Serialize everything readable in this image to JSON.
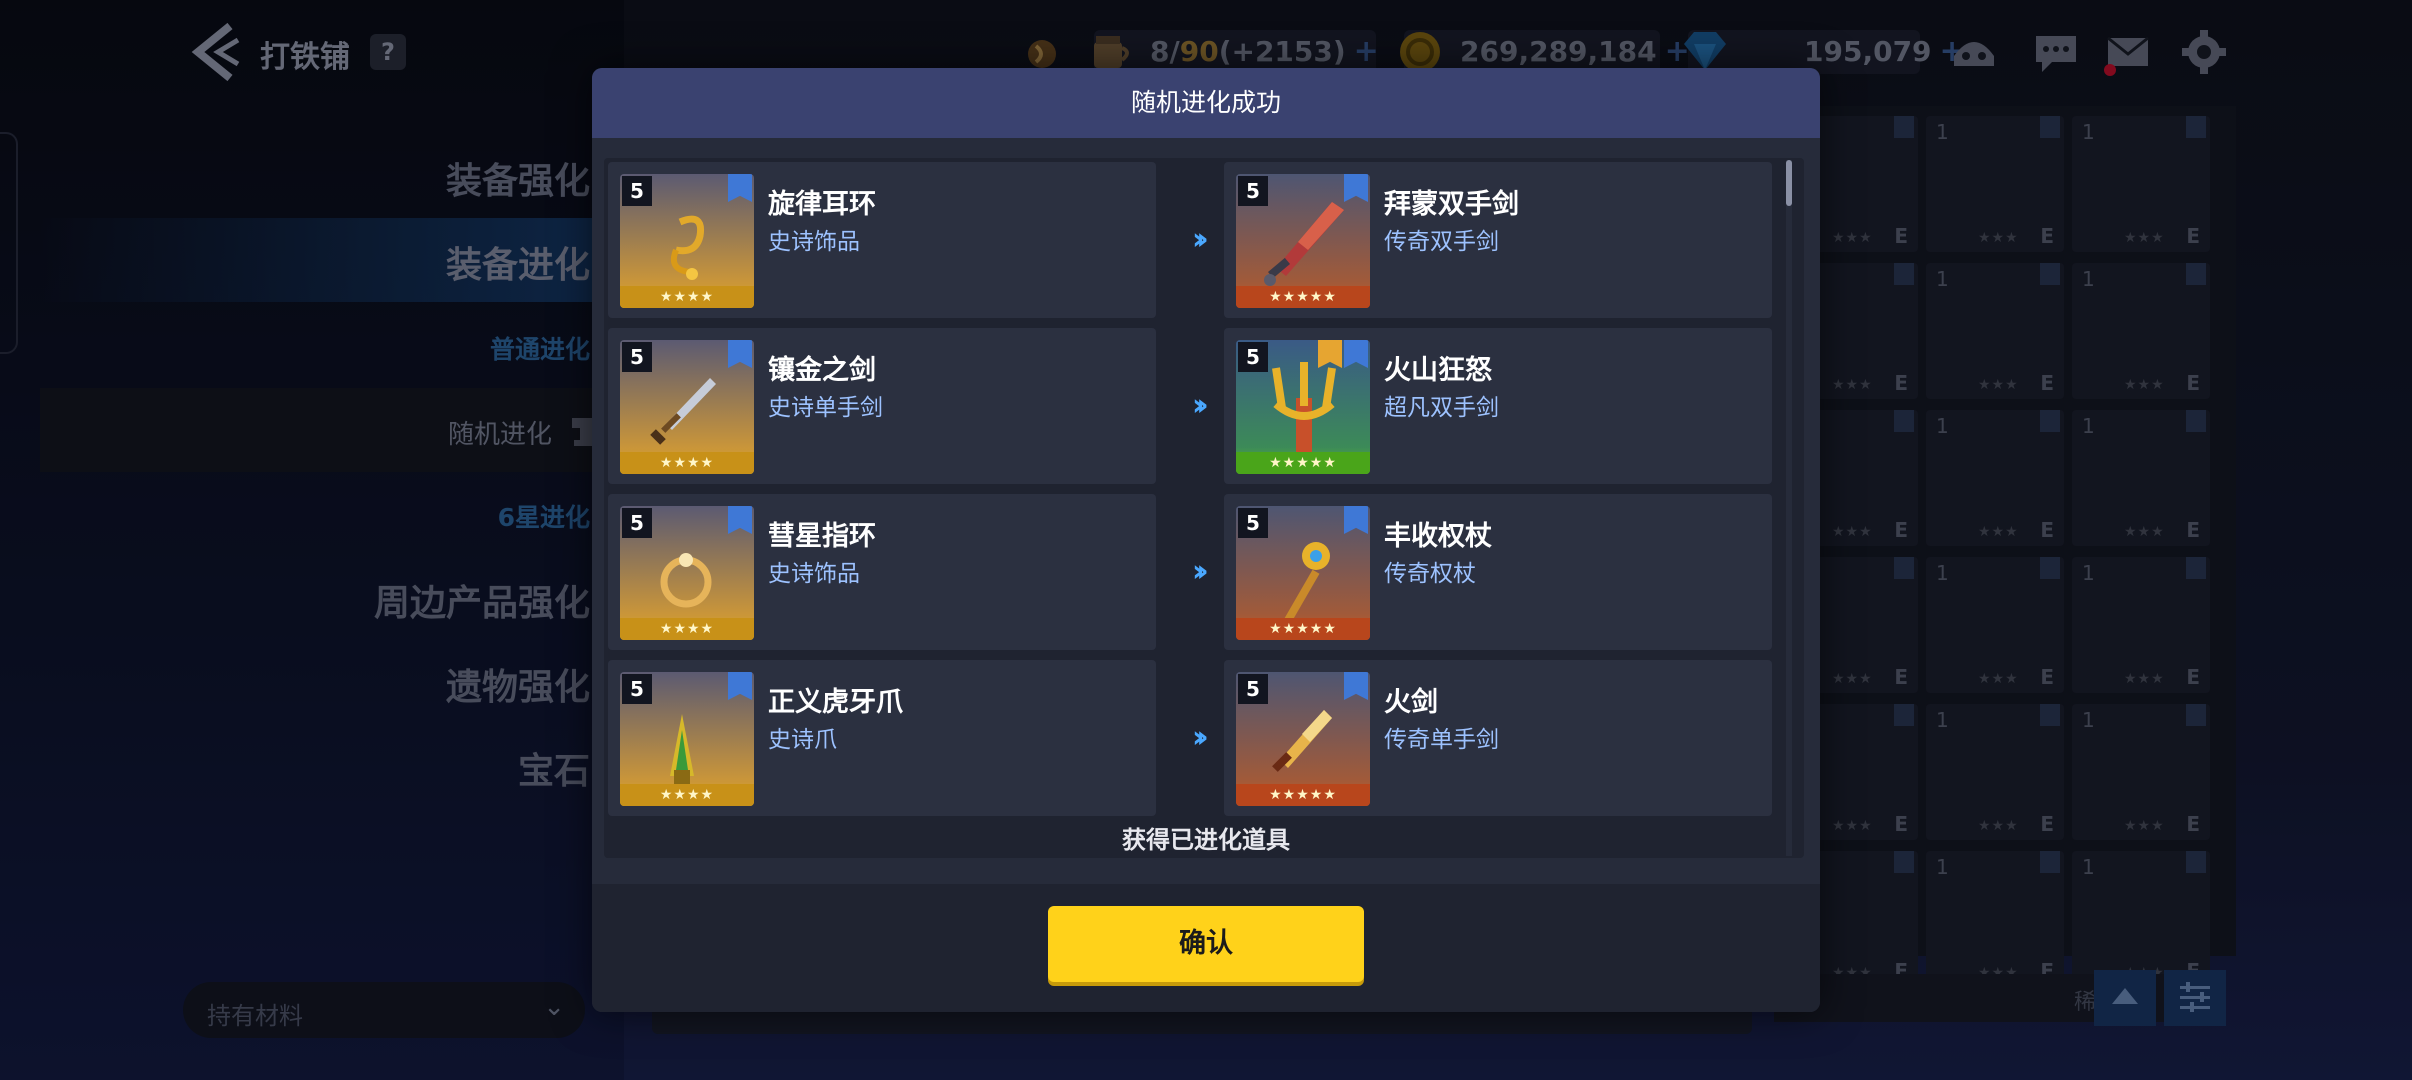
{
  "header": {
    "title": "打铁铺",
    "help_label": "?"
  },
  "resources": {
    "stamina": {
      "current": "8",
      "max": "90",
      "bonus": "(+2153)",
      "plus": "+"
    },
    "gold": {
      "value": "269,289,184",
      "plus": "+"
    },
    "gems": {
      "value": "195,079",
      "plus": "+"
    }
  },
  "menu": {
    "items": [
      {
        "label": "装备强化"
      },
      {
        "label": "装备进化"
      },
      {
        "label": "普通进化"
      },
      {
        "label": "随机进化"
      },
      {
        "label": "6星进化"
      },
      {
        "label": "周边产品强化"
      },
      {
        "label": "遗物强化"
      },
      {
        "label": "宝石"
      }
    ],
    "material_select": "持有材料"
  },
  "inventory": {
    "sort_label": "稀有度",
    "slot_level": "1",
    "slot_grade": "E",
    "slot_stars": "★★★"
  },
  "modal": {
    "title": "随机进化成功",
    "obtain_text": "获得已进化道具",
    "confirm_label": "确认",
    "rows": [
      {
        "from": {
          "level": "5",
          "name": "旋律耳环",
          "type": "史诗饰品",
          "stars": "★★★★",
          "rarity": "epic",
          "icon": "earring-icon"
        },
        "to": {
          "level": "5",
          "name": "拜蒙双手剑",
          "type": "传奇双手剑",
          "stars": "★★★★★",
          "rarity": "legend",
          "icon": "greatsword-icon"
        }
      },
      {
        "from": {
          "level": "5",
          "name": "镶金之剑",
          "type": "史诗单手剑",
          "stars": "★★★★",
          "rarity": "epic",
          "icon": "sword-icon"
        },
        "to": {
          "level": "5",
          "name": "火山狂怒",
          "type": "超凡双手剑",
          "stars": "★★★★★",
          "rarity": "mythic",
          "icon": "trident-icon"
        }
      },
      {
        "from": {
          "level": "5",
          "name": "彗星指环",
          "type": "史诗饰品",
          "stars": "★★★★",
          "rarity": "epic",
          "icon": "ring-icon"
        },
        "to": {
          "level": "5",
          "name": "丰收权杖",
          "type": "传奇权杖",
          "stars": "★★★★★",
          "rarity": "legend",
          "icon": "scepter-icon"
        }
      },
      {
        "from": {
          "level": "5",
          "name": "正义虎牙爪",
          "type": "史诗爪",
          "stars": "★★★★",
          "rarity": "epic",
          "icon": "claw-icon"
        },
        "to": {
          "level": "5",
          "name": "火剑",
          "type": "传奇单手剑",
          "stars": "★★★★★",
          "rarity": "legend",
          "icon": "fire-sword-icon"
        }
      }
    ]
  },
  "colors": {
    "accent_blue": "#4aa8ff",
    "confirm_yellow": "#ffd21a",
    "header_bar": "#3a4270"
  }
}
